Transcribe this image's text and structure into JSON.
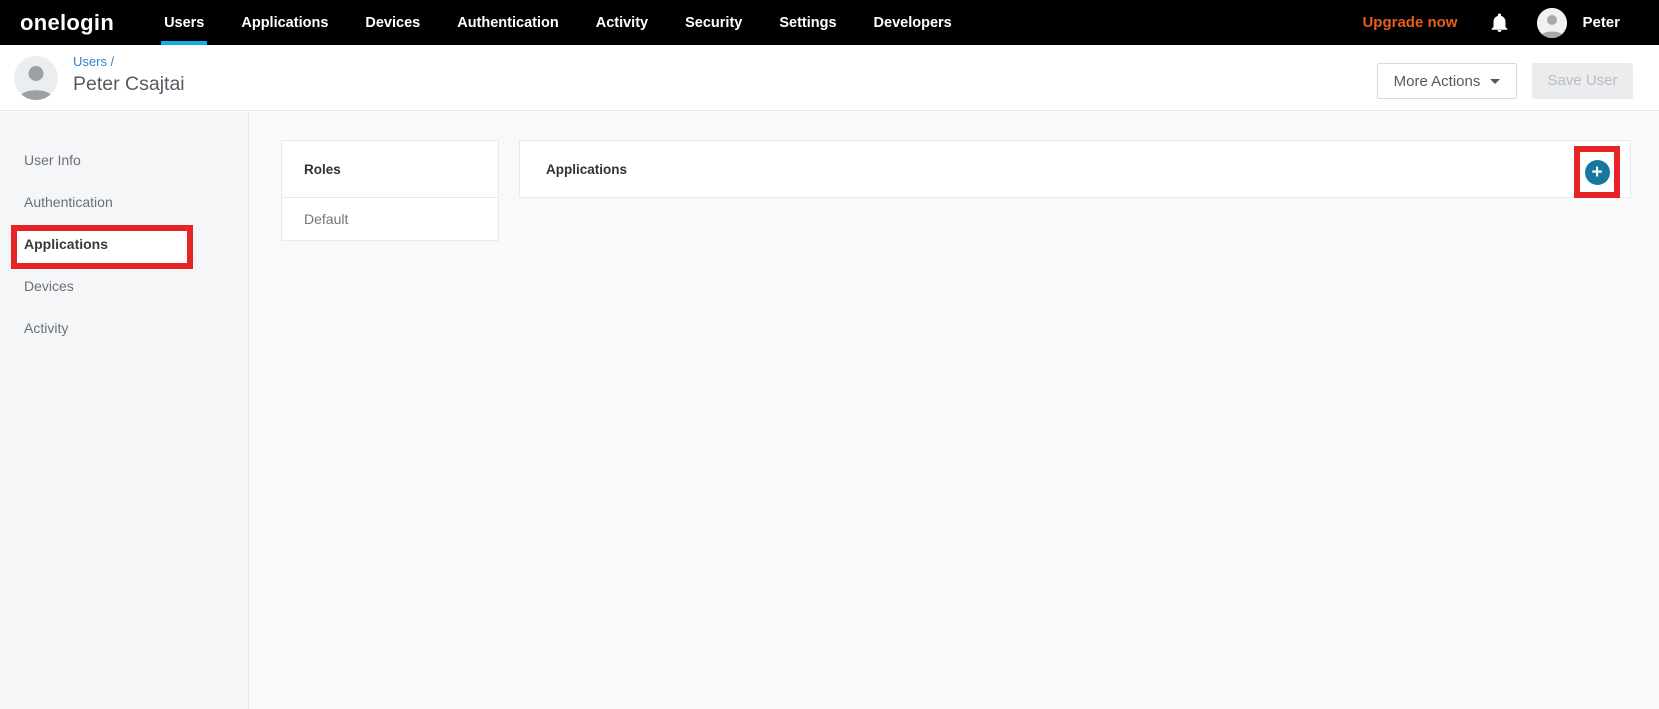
{
  "nav": {
    "logo": "onelogin",
    "items": [
      {
        "label": "Users",
        "active": true
      },
      {
        "label": "Applications",
        "active": false
      },
      {
        "label": "Devices",
        "active": false
      },
      {
        "label": "Authentication",
        "active": false
      },
      {
        "label": "Activity",
        "active": false
      },
      {
        "label": "Security",
        "active": false
      },
      {
        "label": "Settings",
        "active": false
      },
      {
        "label": "Developers",
        "active": false
      }
    ],
    "upgrade_label": "Upgrade now",
    "user_name": "Peter"
  },
  "header": {
    "breadcrumb": "Users /",
    "title": "Peter Csajtai",
    "more_actions_label": "More Actions",
    "save_label": "Save User"
  },
  "sidebar": {
    "items": [
      {
        "label": "User Info",
        "selected": false
      },
      {
        "label": "Authentication",
        "selected": false
      },
      {
        "label": "Applications",
        "selected": true,
        "annotated": true
      },
      {
        "label": "Devices",
        "selected": false
      },
      {
        "label": "Activity",
        "selected": false
      }
    ]
  },
  "main": {
    "roles_card": {
      "title": "Roles",
      "rows": [
        "Default"
      ]
    },
    "applications_panel": {
      "title": "Applications",
      "add_icon": "+"
    }
  },
  "icons": {
    "bell": "notification-bell",
    "avatar": "user-silhouette",
    "caret": "chevron-down",
    "add": "plus-circle"
  },
  "colors": {
    "nav_background": "#000000",
    "accent_cyan": "#16aee2",
    "upgrade_orange": "#e55f19",
    "link_blue": "#3583c4",
    "add_button_blue": "#17789f",
    "annotation_red": "#e62428",
    "sidebar_background": "#f5f6f8",
    "content_background": "#f8f9fb"
  }
}
